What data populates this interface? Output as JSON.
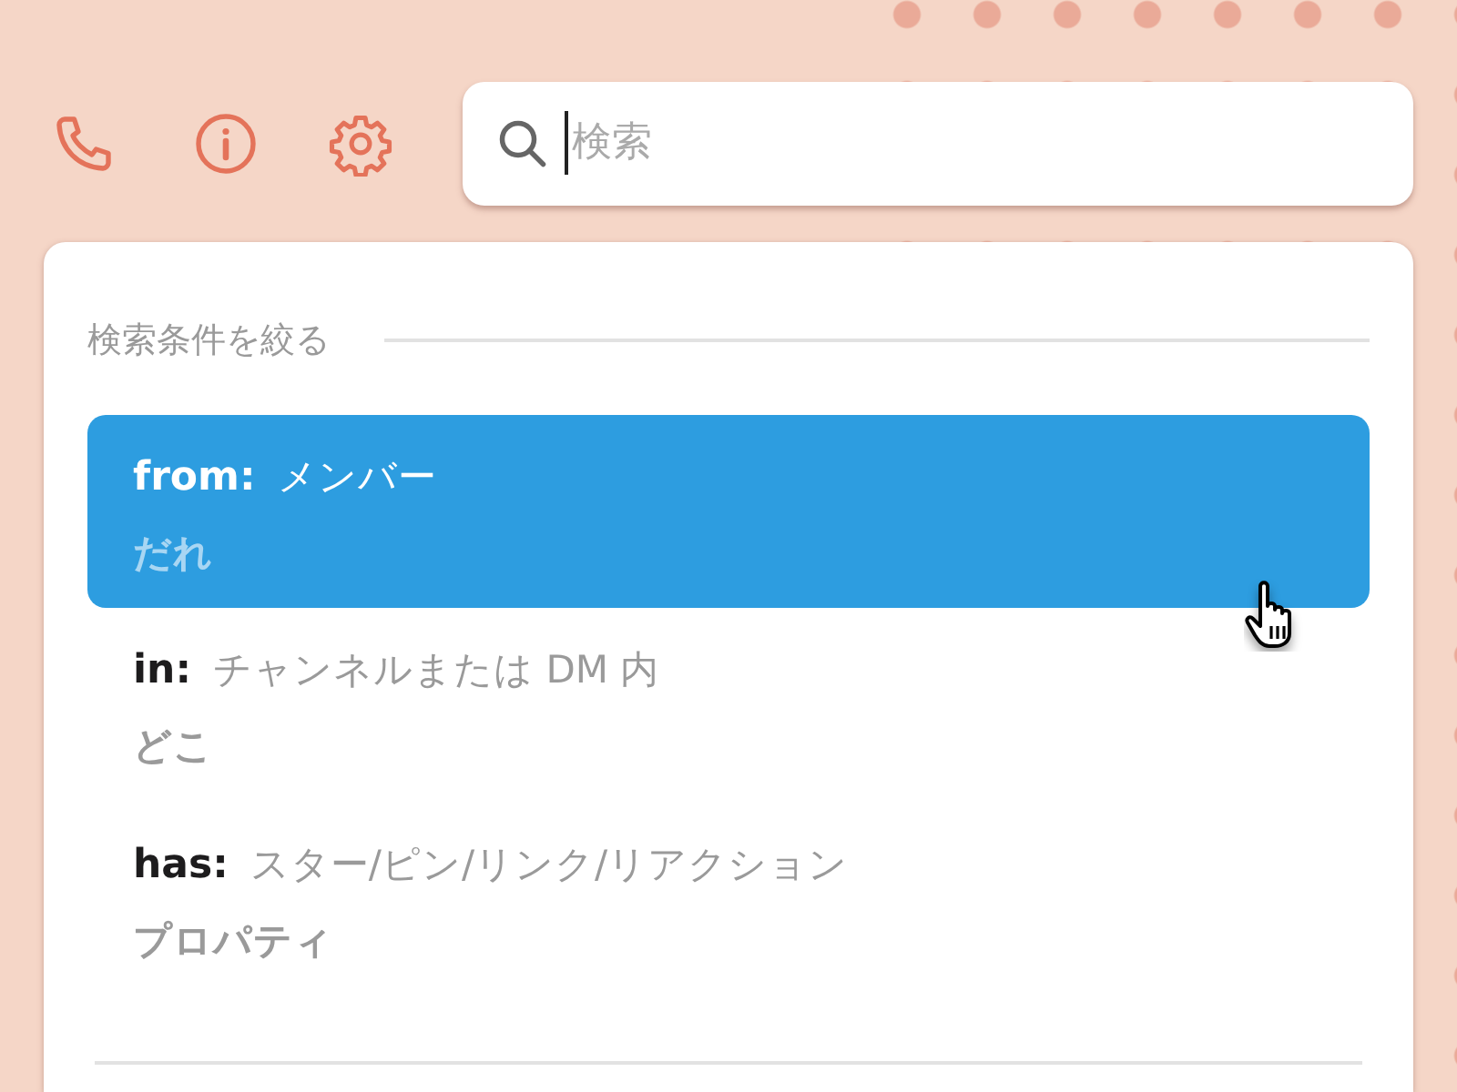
{
  "toolbar": {
    "search": {
      "placeholder": "検索"
    }
  },
  "filter_panel": {
    "title": "検索条件を絞る",
    "filters": [
      {
        "keyword": "from:",
        "description": "メンバー",
        "label": "だれ",
        "selected": true
      },
      {
        "keyword": "in:",
        "description": "チャンネルまたは DM 内",
        "label": "どこ",
        "selected": false
      },
      {
        "keyword": "has:",
        "description": "スター/ピン/リンク/リアクション",
        "label": "プロパティ",
        "selected": false
      }
    ]
  }
}
